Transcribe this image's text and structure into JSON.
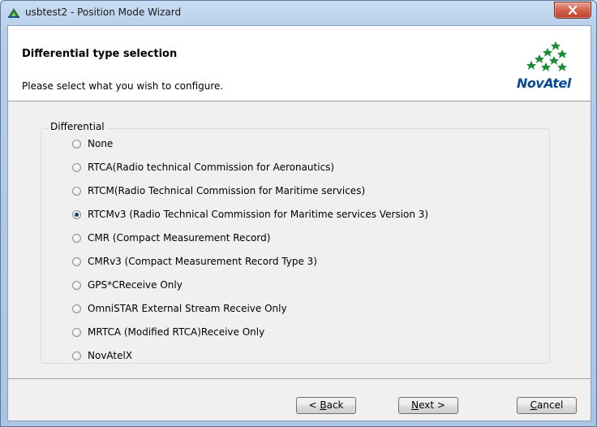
{
  "window": {
    "title": "usbtest2 - Position Mode Wizard",
    "close_glyph": "x"
  },
  "header": {
    "title": "Differential type selection",
    "subtitle": "Please select what you wish to configure.",
    "logo_text": "NovAtel"
  },
  "group": {
    "legend": "Differential",
    "selected_index": 3,
    "options": [
      "None",
      "RTCA(Radio technical Commission for Aeronautics)",
      "RTCM(Radio Technical Commission for Maritime services)",
      "RTCMv3 (Radio Technical Commission for Maritime services Version 3)",
      "CMR (Compact Measurement Record)",
      "CMRv3 (Compact Measurement Record Type 3)",
      "GPS*CReceive Only",
      "OmniSTAR External Stream Receive Only",
      "MRTCA (Modified RTCA)Receive Only",
      "NovAtelX"
    ]
  },
  "buttons": {
    "back": {
      "prefix": "< ",
      "mnemonic": "B",
      "rest": "ack"
    },
    "next": {
      "prefix": "",
      "mnemonic": "N",
      "rest": "ext >"
    },
    "cancel": {
      "prefix": "",
      "mnemonic": "C",
      "rest": "ancel"
    }
  },
  "colors": {
    "accent": "#0b4a8a",
    "logo_green": "#1f8a3a",
    "close_red": "#c0402a"
  }
}
